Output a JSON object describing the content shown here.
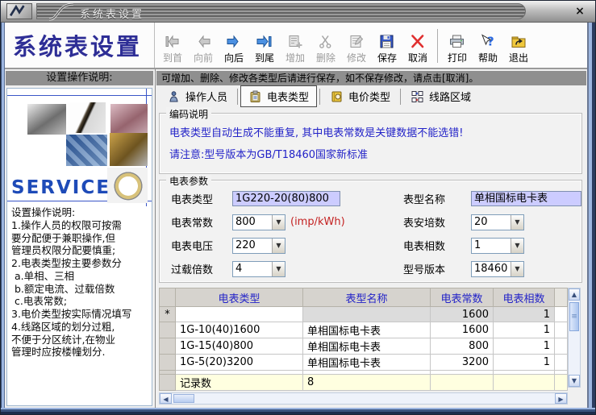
{
  "window": {
    "title": "系统表设置"
  },
  "header": {
    "app_title": "系统表设置"
  },
  "icons": {
    "combo_arrow": "▼",
    "scroll_up": "▲",
    "scroll_down": "▼",
    "scroll_left": "◀",
    "scroll_right": "▶",
    "close": "×",
    "grip": "≡"
  },
  "colors": {
    "accent_text": "#2323c8",
    "warning_text": "#c42222",
    "field_bg": "#ccccff",
    "bar_bg": "#8f8f8f",
    "footer_row_bg": "#ffffe0"
  },
  "toolbar": {
    "items": [
      {
        "label": "到首",
        "enabled": false
      },
      {
        "label": "向前",
        "enabled": false
      },
      {
        "label": "向后",
        "enabled": true
      },
      {
        "label": "到尾",
        "enabled": true
      },
      {
        "label": "增加",
        "enabled": false
      },
      {
        "label": "删除",
        "enabled": false
      },
      {
        "label": "修改",
        "enabled": false
      },
      {
        "label": "保存",
        "enabled": true
      },
      {
        "label": "取消",
        "enabled": true
      },
      {
        "label": "打印",
        "enabled": true
      },
      {
        "label": "帮助",
        "enabled": true
      },
      {
        "label": "退出",
        "enabled": true
      }
    ]
  },
  "sidebar": {
    "header": "设置操作说明:",
    "service_text": "SERVICE",
    "instructions": "设置操作说明:\n1.操作人员的权限可按需\n要分配便于兼职操作,但\n管理员权限分配要慎重;\n2.电表类型按主要参数分\n a.单相、三相\n b.额定电流、过载倍数\n c.电表常数;\n3.电价类型按实际情况填写\n4.线路区域的划分过粗,\n不便于分区统计,在物业\n管理时应按楼幢划分."
  },
  "main": {
    "notice": "可增加、删除、修改各类型后请进行保存，如不保存修改，请点击[取消]。",
    "tabs": [
      {
        "label": "操作人员",
        "selected": false
      },
      {
        "label": "电表类型",
        "selected": true
      },
      {
        "label": "电价类型",
        "selected": false
      },
      {
        "label": "线路区域",
        "selected": false
      }
    ],
    "coding_box": {
      "title": "编码说明",
      "line1": "电表类型自动生成不能重复, 其中电表常数是关键数据不能选错!",
      "line2": "请注意:型号版本为GB/T18460国家新标准"
    },
    "params_box": {
      "title": "电表参数",
      "meter_type": {
        "label": "电表类型",
        "value": "1G220-20(80)800"
      },
      "model_name": {
        "label": "表型名称",
        "value": "单相国标电卡表"
      },
      "meter_constant": {
        "label": "电表常数",
        "value": "800",
        "suffix": "(imp/kWh)"
      },
      "ampere": {
        "label": "表安培数",
        "value": "20"
      },
      "voltage": {
        "label": "电表电压",
        "value": "220"
      },
      "phases": {
        "label": "电表相数",
        "value": "1"
      },
      "overload": {
        "label": "过载倍数",
        "value": "4"
      },
      "model_version": {
        "label": "型号版本",
        "value": "18460"
      }
    },
    "table": {
      "headers": {
        "type": "电表类型",
        "name": "表型名称",
        "constant": "电表常数",
        "phases": "电表相数"
      },
      "new_row": {
        "marker": "*",
        "type": "",
        "name": "",
        "constant": "1600",
        "phases": "1"
      },
      "rows": [
        {
          "type": "1G-10(40)1600",
          "name": "单相国标电卡表",
          "constant": "1600",
          "phases": "1"
        },
        {
          "type": "1G-15(40)800",
          "name": "单相国标电卡表",
          "constant": "800",
          "phases": "1"
        },
        {
          "type": "1G-5(20)3200",
          "name": "单相国标电卡表",
          "constant": "3200",
          "phases": "1"
        }
      ],
      "footer": {
        "label": "记录数",
        "value": "8"
      }
    }
  }
}
